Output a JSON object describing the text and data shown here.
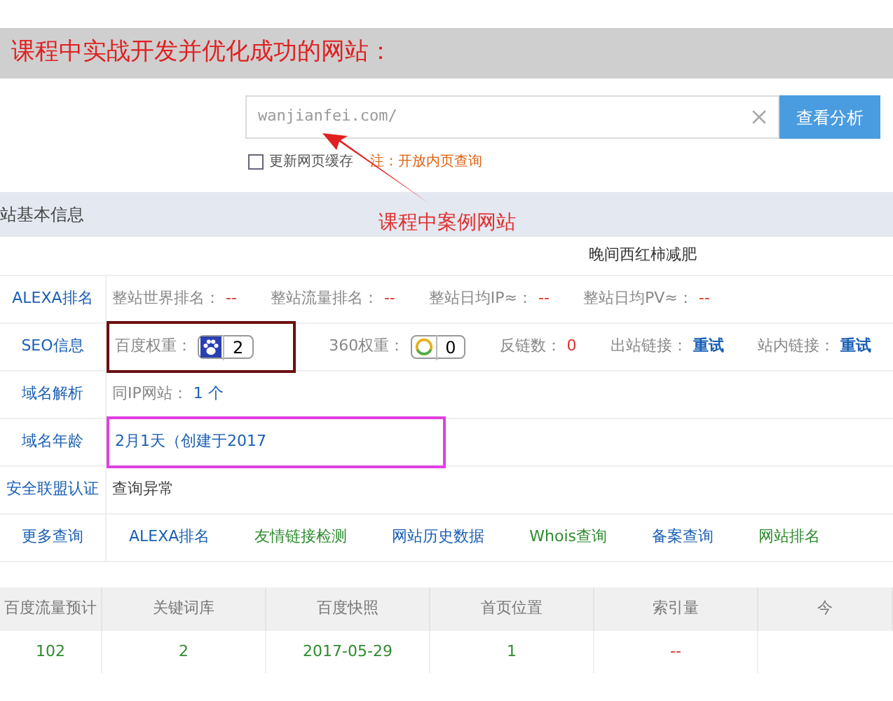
{
  "header": {
    "title": "课程中实战开发并优化成功的网站："
  },
  "search": {
    "value": "wanjianfei.com/",
    "button": "查看分析"
  },
  "options": {
    "checkbox": {
      "label": "更新网页缓存",
      "checked": false
    },
    "note": "注：开放内页查询"
  },
  "section": {
    "title": "站基本信息",
    "annotation": "课程中案例网站"
  },
  "site_title": "晚间西红柿减肥",
  "rows": [
    {
      "label": "ALEXA排名",
      "items": [
        {
          "kind": "label",
          "text": "整站世界排名："
        },
        {
          "kind": "dash",
          "text": "--"
        },
        {
          "kind": "label",
          "text": "整站流量排名："
        },
        {
          "kind": "dash",
          "text": "--"
        },
        {
          "kind": "label",
          "text": "整站日均IP≈："
        },
        {
          "kind": "dash",
          "text": "--"
        },
        {
          "kind": "label",
          "text": "整站日均PV≈："
        },
        {
          "kind": "dash",
          "text": "--"
        }
      ]
    },
    {
      "label": "SEO信息",
      "color": "#6b1010",
      "items": [
        {
          "kind": "label",
          "text": "百度权重："
        },
        {
          "kind": "paw-badge",
          "text": "2"
        },
        {
          "kind": "label",
          "text": "360权重："
        },
        {
          "kind": "ring-badge",
          "text": "0"
        },
        {
          "kind": "label",
          "text": "反链数："
        },
        {
          "kind": "dash",
          "text": "0"
        },
        {
          "kind": "label",
          "text": "出站链接："
        },
        {
          "kind": "link",
          "text": "重试"
        },
        {
          "kind": "label",
          "text": "站内链接："
        },
        {
          "kind": "link",
          "text": "重试"
        }
      ]
    },
    {
      "label": "域名解析",
      "items": [
        {
          "kind": "label",
          "text": "同IP网站："
        },
        {
          "kind": "value",
          "text": "1 个"
        }
      ]
    },
    {
      "label": "域名年龄",
      "color": "#e040e0",
      "items": [
        {
          "kind": "value",
          "text": "2月1天（创建于2017"
        }
      ]
    },
    {
      "label": "安全联盟认证",
      "items": [
        {
          "kind": "plain",
          "text": "查询异常"
        }
      ]
    },
    {
      "label": "更多查询",
      "items": [
        {
          "kind": "colored",
          "text": "ALEXA排名",
          "color": "#1a5fb4"
        },
        {
          "kind": "colored",
          "text": "友情链接检测",
          "color": "#2e8b2e"
        },
        {
          "kind": "colored",
          "text": "网站历史数据",
          "color": "#1a5fb4"
        },
        {
          "kind": "colored",
          "text": "Whois查询",
          "color": "#2e8b2e"
        },
        {
          "kind": "colored",
          "text": "备案查询",
          "color": "#1a5fb4"
        },
        {
          "kind": "colored",
          "text": "网站排名",
          "color": "#2e8b2e"
        }
      ]
    }
  ],
  "stats": {
    "columns": [
      "百度流量预计",
      "关键词库",
      "百度快照",
      "首页位置",
      "索引量",
      "今"
    ],
    "row": [
      {
        "text": "102",
        "kind": "value"
      },
      {
        "text": "2",
        "kind": "value"
      },
      {
        "text": "2017-05-29",
        "kind": "value"
      },
      {
        "text": "1",
        "kind": "value"
      },
      {
        "text": "--",
        "kind": "dash"
      }
    ]
  }
}
